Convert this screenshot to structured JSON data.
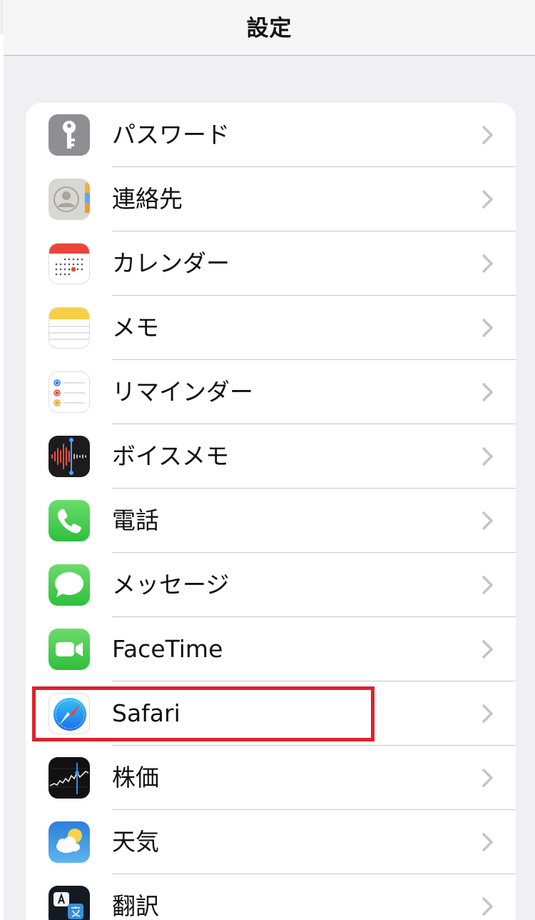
{
  "header": {
    "title": "設定"
  },
  "settings": {
    "items": [
      {
        "label": "パスワード",
        "icon": "key-icon"
      },
      {
        "label": "連絡先",
        "icon": "contacts-icon"
      },
      {
        "label": "カレンダー",
        "icon": "calendar-icon"
      },
      {
        "label": "メモ",
        "icon": "notes-icon"
      },
      {
        "label": "リマインダー",
        "icon": "reminders-icon"
      },
      {
        "label": "ボイスメモ",
        "icon": "voice-memos-icon"
      },
      {
        "label": "電話",
        "icon": "phone-icon"
      },
      {
        "label": "メッセージ",
        "icon": "messages-icon"
      },
      {
        "label": "FaceTime",
        "icon": "facetime-icon"
      },
      {
        "label": "Safari",
        "icon": "safari-icon"
      },
      {
        "label": "株価",
        "icon": "stocks-icon"
      },
      {
        "label": "天気",
        "icon": "weather-icon"
      },
      {
        "label": "翻訳",
        "icon": "translate-icon"
      }
    ],
    "highlighted_item": "Safari"
  },
  "colors": {
    "background": "#efeff4",
    "highlight": "#e0212c",
    "chevron": "#c4c4c7",
    "separator": "#c8c7cc"
  }
}
